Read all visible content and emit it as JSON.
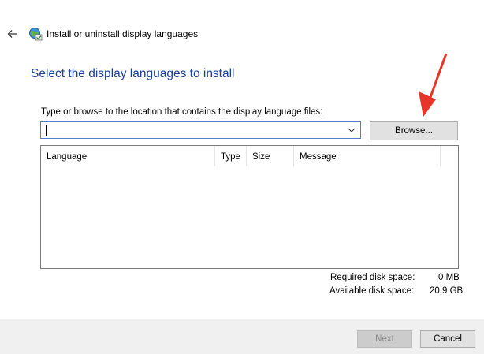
{
  "window": {
    "title": "Install or uninstall display languages"
  },
  "heading": "Select the display languages to install",
  "path": {
    "label": "Type or browse to the location that contains the display language files:",
    "value": ""
  },
  "browse_label": "Browse...",
  "table": {
    "columns": [
      "Language",
      "Type",
      "Size",
      "Message"
    ],
    "rows": []
  },
  "disk": {
    "required_label": "Required disk space:",
    "required_value": "0 MB",
    "available_label": "Available disk space:",
    "available_value": "20.9 GB"
  },
  "buttons": {
    "next": "Next",
    "cancel": "Cancel"
  },
  "colors": {
    "heading": "#1a3e9e",
    "annotation_arrow": "#e8352a",
    "input_border": "#4f7fcf"
  },
  "icons": [
    "back-arrow-icon",
    "language-globe-icon",
    "chevron-down-icon",
    "annotation-arrow-icon"
  ]
}
